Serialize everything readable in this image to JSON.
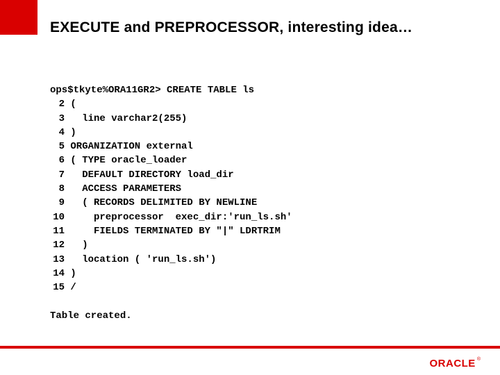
{
  "title": "EXECUTE and PREPROCESSOR, interesting idea…",
  "code": {
    "prompt": "ops$tkyte%ORA11GR2> CREATE TABLE ls",
    "lines": [
      {
        "n": "2",
        "t": "("
      },
      {
        "n": "3",
        "t": "  line varchar2(255)"
      },
      {
        "n": "4",
        "t": ")"
      },
      {
        "n": "5",
        "t": "ORGANIZATION external"
      },
      {
        "n": "6",
        "t": "( TYPE oracle_loader"
      },
      {
        "n": "7",
        "t": "  DEFAULT DIRECTORY load_dir"
      },
      {
        "n": "8",
        "t": "  ACCESS PARAMETERS"
      },
      {
        "n": "9",
        "t": "  ( RECORDS DELIMITED BY NEWLINE"
      },
      {
        "n": "10",
        "t": "    preprocessor  exec_dir:'run_ls.sh'"
      },
      {
        "n": "11",
        "t": "    FIELDS TERMINATED BY \"|\" LDRTRIM"
      },
      {
        "n": "12",
        "t": "  )"
      },
      {
        "n": "13",
        "t": "  location ( 'run_ls.sh')"
      },
      {
        "n": "14",
        "t": ")"
      },
      {
        "n": "15",
        "t": "/"
      }
    ],
    "result": "Table created."
  },
  "logo": {
    "text": "ORACLE",
    "reg": "®"
  },
  "colors": {
    "accent": "#d90000"
  }
}
